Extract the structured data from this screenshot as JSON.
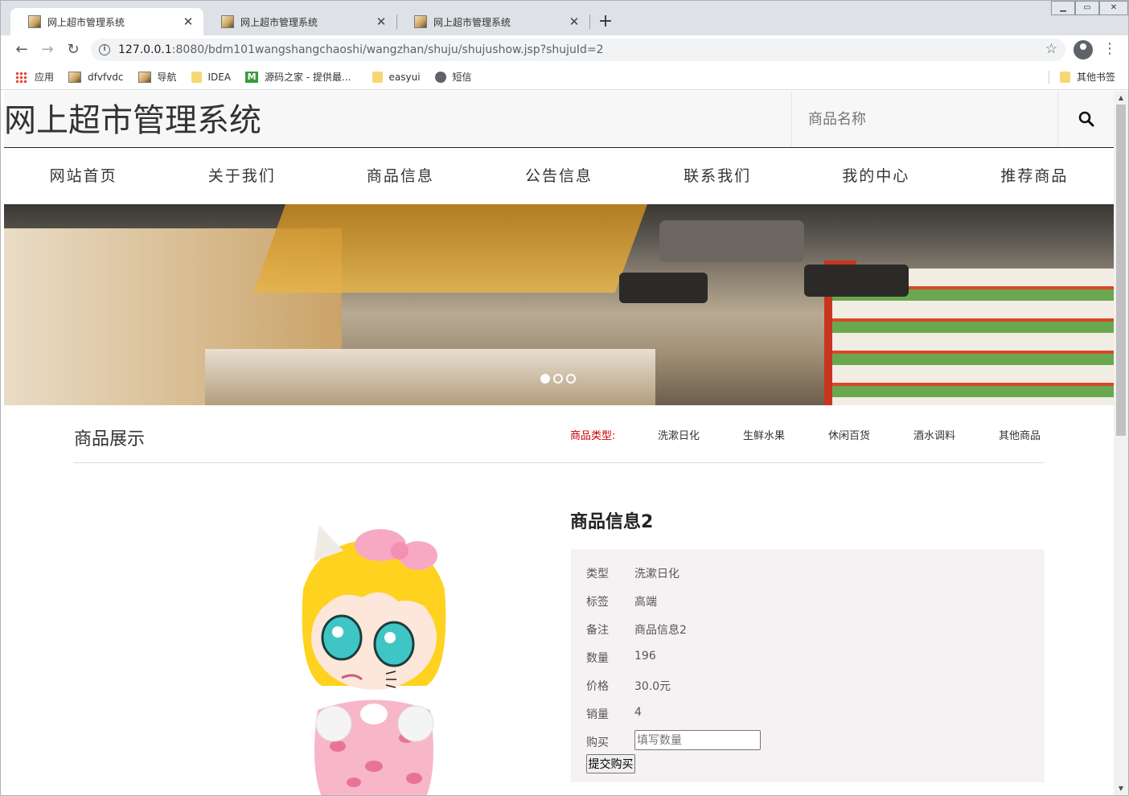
{
  "browser": {
    "tabs": [
      {
        "title": "网上超市管理系统",
        "active": true
      },
      {
        "title": "网上超市管理系统",
        "active": false
      },
      {
        "title": "网上超市管理系统",
        "active": false
      }
    ],
    "url_host": "127.0.0.1",
    "url_path": ":8080/bdm101wangshangchaoshi/wangzhan/shuju/shujushow.jsp?shujuId=2",
    "bookmarks": [
      {
        "label": "应用",
        "icon": "apps-icon"
      },
      {
        "label": "dfvfvdc",
        "icon": "image-icon"
      },
      {
        "label": "导航",
        "icon": "image-icon"
      },
      {
        "label": "IDEA",
        "icon": "folder-icon"
      },
      {
        "label": "源码之家 - 提供最...",
        "icon": "m-icon"
      },
      {
        "label": "easyui",
        "icon": "folder-icon"
      },
      {
        "label": "短信",
        "icon": "globe-icon"
      }
    ],
    "other_bookmarks": "其他书签"
  },
  "site": {
    "title": "网上超市管理系统",
    "search_placeholder": "商品名称",
    "nav": [
      "网站首页",
      "关于我们",
      "商品信息",
      "公告信息",
      "联系我们",
      "我的中心",
      "推荐商品"
    ],
    "banner_dots": 3,
    "banner_active_dot": 0
  },
  "section": {
    "title": "商品展示",
    "category_label": "商品类型:",
    "categories": [
      "洗漱日化",
      "生鲜水果",
      "休闲百货",
      "酒水调料",
      "其他商品"
    ]
  },
  "product": {
    "name": "商品信息2",
    "fields": [
      {
        "key": "类型",
        "value": "洗漱日化"
      },
      {
        "key": "标签",
        "value": "高端"
      },
      {
        "key": "备注",
        "value": "商品信息2"
      },
      {
        "key": "数量",
        "value": "196"
      },
      {
        "key": "价格",
        "value": "30.0元"
      },
      {
        "key": "销量",
        "value": "4"
      }
    ],
    "buy_label": "购买",
    "qty_placeholder": "填写数量",
    "submit_label": "提交购买"
  },
  "colors": {
    "category_label": "#cc0000",
    "detail_bg": "#f6f2f4"
  }
}
